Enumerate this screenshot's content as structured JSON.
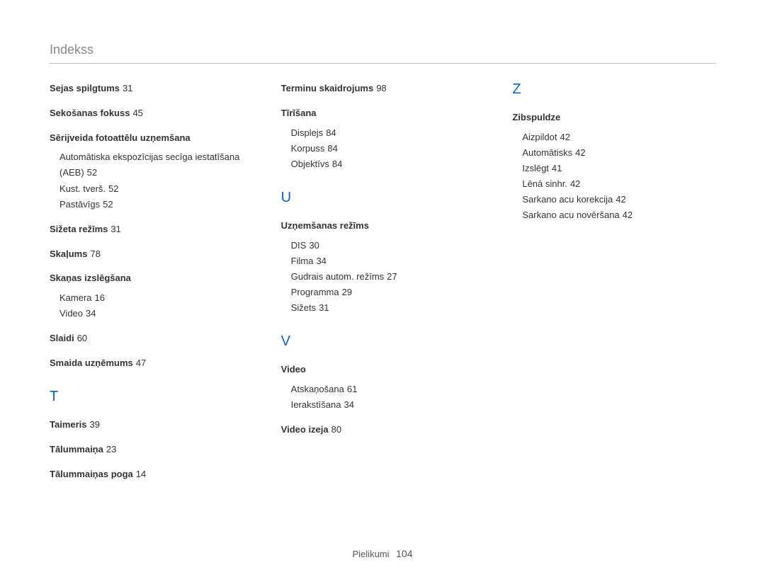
{
  "header": "Indekss",
  "footer": {
    "label": "Pielikumi",
    "page": "104"
  },
  "columns": [
    [
      {
        "type": "bold",
        "text": "Sejas spilgtums",
        "page": "31"
      },
      {
        "type": "bold",
        "text": "Sekošanas fokuss",
        "page": "45"
      },
      {
        "type": "bold",
        "text": "Sērijveida fotoattēlu uzņemšana"
      },
      {
        "type": "sub",
        "text": "Automātiska ekspozīcijas secīga iestatīšana (AEB)",
        "page": "52"
      },
      {
        "type": "sub",
        "text": "Kust. tverš.",
        "page": "52"
      },
      {
        "type": "sub",
        "text": "Pastāvīgs",
        "page": "52"
      },
      {
        "type": "bold",
        "text": "Sižeta režīms",
        "page": "31"
      },
      {
        "type": "bold",
        "text": "Skaļums",
        "page": "78"
      },
      {
        "type": "bold",
        "text": "Skaņas izslēgšana"
      },
      {
        "type": "sub",
        "text": "Kamera",
        "page": "16"
      },
      {
        "type": "sub",
        "text": "Video",
        "page": "34"
      },
      {
        "type": "bold",
        "text": "Slaidi",
        "page": "60"
      },
      {
        "type": "bold",
        "text": "Smaida uzņēmums",
        "page": "47"
      },
      {
        "type": "letter",
        "text": "T"
      },
      {
        "type": "bold",
        "text": "Taimeris",
        "page": "39"
      },
      {
        "type": "bold",
        "text": "Tālummaiņa",
        "page": "23"
      },
      {
        "type": "bold",
        "text": "Tālummaiņas poga",
        "page": "14"
      }
    ],
    [
      {
        "type": "bold",
        "text": "Terminu skaidrojums",
        "page": "98"
      },
      {
        "type": "bold",
        "text": "Tīrīšana"
      },
      {
        "type": "sub",
        "text": "Displejs",
        "page": "84"
      },
      {
        "type": "sub",
        "text": "Korpuss",
        "page": "84"
      },
      {
        "type": "sub",
        "text": "Objektīvs",
        "page": "84"
      },
      {
        "type": "letter",
        "text": "U"
      },
      {
        "type": "bold",
        "text": "Uzņemšanas režīms"
      },
      {
        "type": "sub",
        "text": "DIS",
        "page": "30"
      },
      {
        "type": "sub",
        "text": "Filma",
        "page": "34"
      },
      {
        "type": "sub",
        "text": "Gudrais autom. režīms",
        "page": "27"
      },
      {
        "type": "sub",
        "text": "Programma",
        "page": "29"
      },
      {
        "type": "sub",
        "text": "Sižets",
        "page": "31"
      },
      {
        "type": "letter",
        "text": "V"
      },
      {
        "type": "bold",
        "text": "Video"
      },
      {
        "type": "sub",
        "text": "Atskaņošana",
        "page": "61"
      },
      {
        "type": "sub",
        "text": "Ierakstīšana",
        "page": "34"
      },
      {
        "type": "bold",
        "text": "Video izeja",
        "page": "80"
      }
    ],
    [
      {
        "type": "letter",
        "text": "Z"
      },
      {
        "type": "bold",
        "text": "Zibspuldze"
      },
      {
        "type": "sub",
        "text": "Aizpildot",
        "page": "42"
      },
      {
        "type": "sub",
        "text": "Automātisks",
        "page": "42"
      },
      {
        "type": "sub",
        "text": "Izslēgt",
        "page": "41"
      },
      {
        "type": "sub",
        "text": "Lēnā sinhr.",
        "page": "42"
      },
      {
        "type": "sub",
        "text": "Sarkano acu korekcija",
        "page": "42"
      },
      {
        "type": "sub",
        "text": "Sarkano acu novēršana",
        "page": "42"
      }
    ]
  ]
}
